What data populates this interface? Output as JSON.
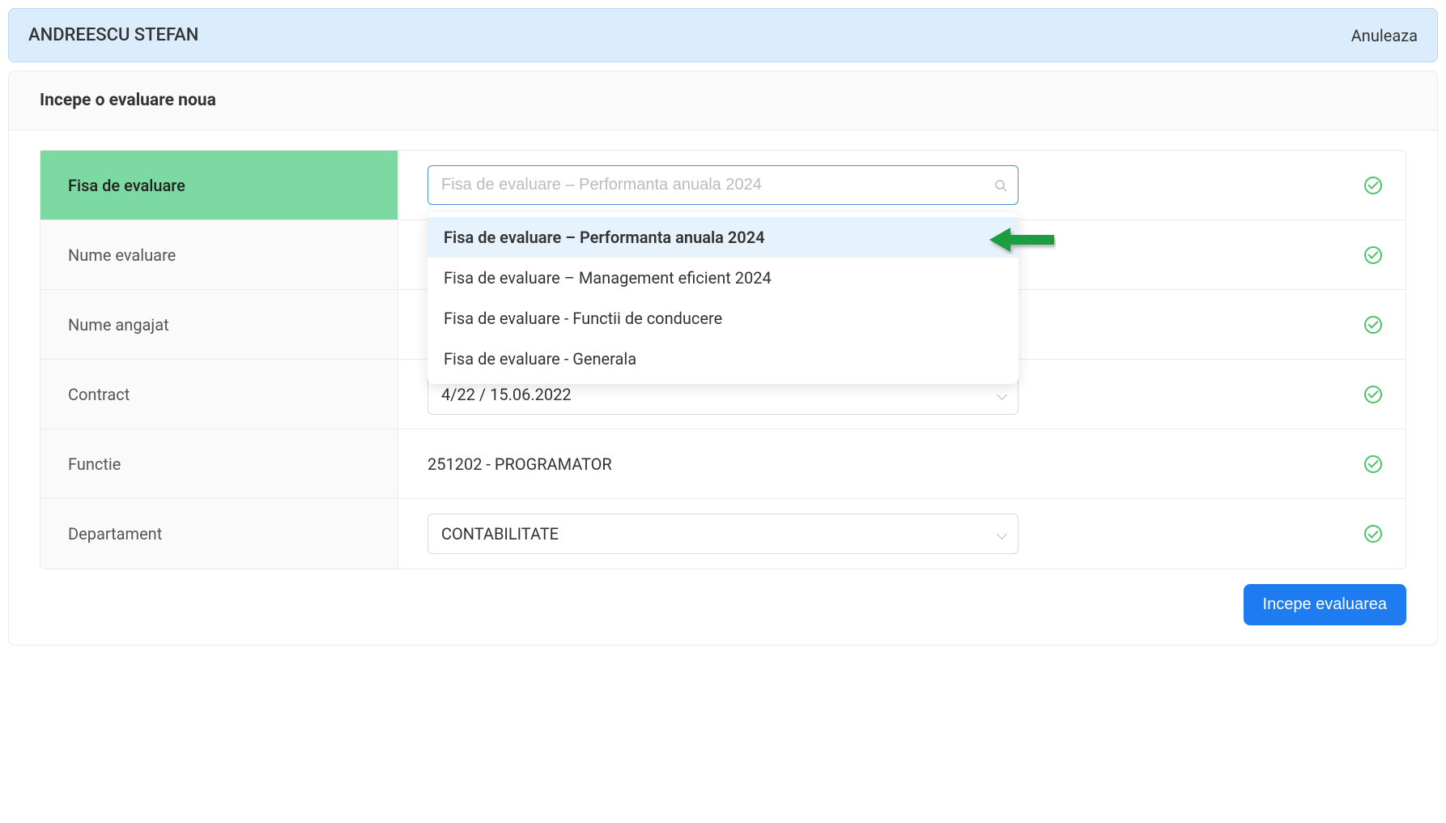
{
  "header": {
    "name": "ANDREESCU STEFAN",
    "cancel": "Anuleaza"
  },
  "card": {
    "title": "Incepe o evaluare noua"
  },
  "rows": {
    "fisa": {
      "label": "Fisa de evaluare",
      "placeholder": "Fisa de evaluare – Performanta anuala 2024"
    },
    "nume_evaluare": {
      "label": "Nume evaluare"
    },
    "nume_angajat": {
      "label": "Nume angajat"
    },
    "contract": {
      "label": "Contract",
      "value": "4/22 / 15.06.2022"
    },
    "functie": {
      "label": "Functie",
      "value": "251202 - PROGRAMATOR"
    },
    "departament": {
      "label": "Departament",
      "value": "CONTABILITATE"
    }
  },
  "dropdown": [
    "Fisa de evaluare – Performanta anuala 2024",
    "Fisa de evaluare – Management eficient 2024",
    "Fisa de evaluare - Functii de conducere",
    "Fisa de evaluare - Generala"
  ],
  "footer": {
    "submit": "Incepe evaluarea"
  }
}
